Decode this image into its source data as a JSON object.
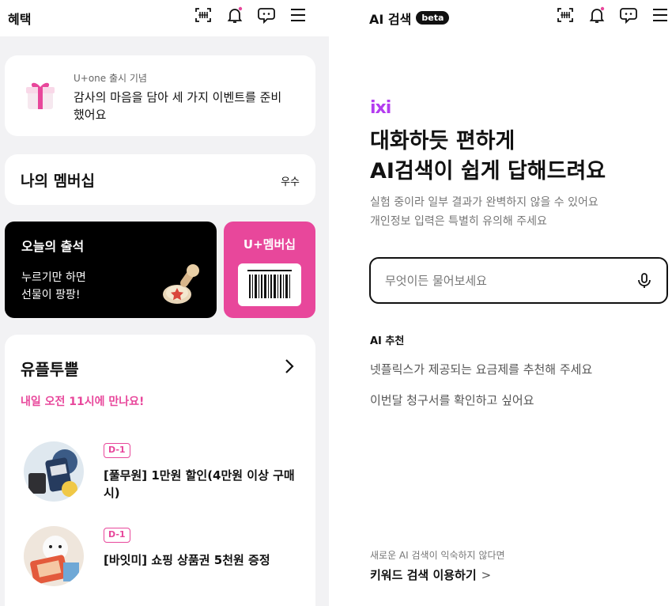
{
  "left": {
    "title": "혜택",
    "event": {
      "small": "U+one 출시 기념",
      "main": "감사의 마음을 담아 세 가지 이벤트를 준비했어요"
    },
    "membership": {
      "title": "나의 멤버십",
      "grade": "우수"
    },
    "attendance": {
      "title": "오늘의 출석",
      "sub_line1": "누르기만 하면",
      "sub_line2": "선물이 팡팡!"
    },
    "uplus_card": {
      "title": "U+멤버십"
    },
    "utp": {
      "title": "유플투쁠",
      "subtitle": "내일 오전 11시에 만나요!",
      "products": [
        {
          "badge": "D-1",
          "title": "[풀무원] 1만원 할인(4만원 이상 구매시)"
        },
        {
          "badge": "D-1",
          "title": "[바잇미] 쇼핑 상품권 5천원 증정"
        }
      ]
    }
  },
  "right": {
    "title": "AI 검색",
    "badge": "beta",
    "logo": "ixi",
    "hero_line1": "대화하듯 편하게",
    "hero_line2": "AI검색이 쉽게 답해드려요",
    "desc_line1": "실험 중이라 일부 결과가 완벽하지 않을 수 있어요",
    "desc_line2": "개인정보 입력은 특별히 유의해 주세요",
    "search": {
      "placeholder": "무엇이든 물어보세요",
      "value": ""
    },
    "recommend_label": "AI 추천",
    "recommendations": [
      "넷플릭스가 제공되는 요금제를 추천해 주세요",
      "이번달 청구서를 확인하고 싶어요"
    ],
    "footer_small": "새로운 AI 검색이 익숙하지 않다면",
    "footer_link": "키워드 검색 이용하기",
    "footer_chevron": ">"
  },
  "icons": [
    "qr-scan-icon",
    "bell-icon",
    "chatbot-icon",
    "menu-icon"
  ],
  "colors": {
    "accent_pink": "#e8479b",
    "ixi_purple": "#b43cf0",
    "notification_dot": "#e8479b",
    "background_gray": "#f2f2f4"
  }
}
